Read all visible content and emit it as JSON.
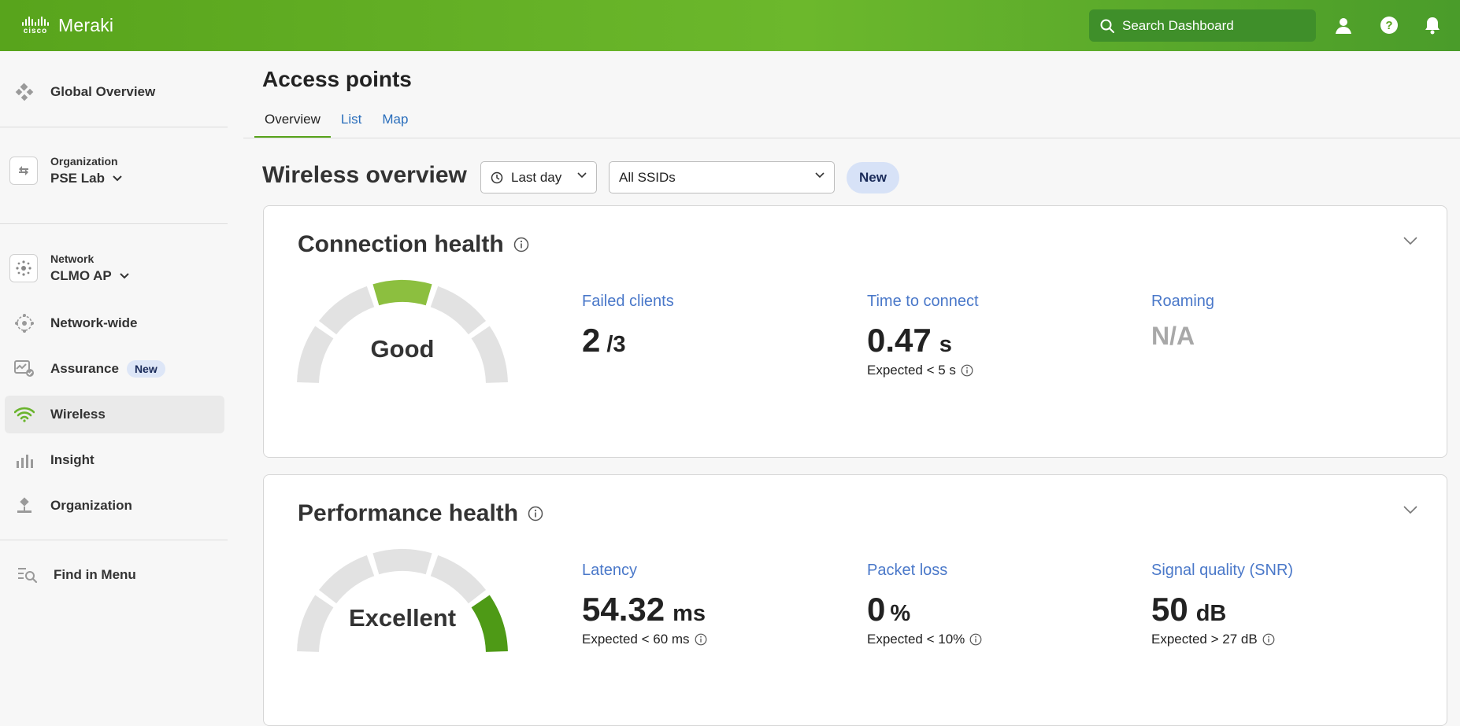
{
  "app": {
    "brand_small": "cisco",
    "brand": "Meraki"
  },
  "header": {
    "search_placeholder": "Search Dashboard"
  },
  "sidebar": {
    "global_overview": "Global Overview",
    "organization": {
      "label": "Organization",
      "value": "PSE Lab"
    },
    "network": {
      "label": "Network",
      "value": "CLMO AP"
    },
    "items": [
      {
        "label": "Network-wide"
      },
      {
        "label": "Assurance",
        "badge": "New"
      },
      {
        "label": "Wireless"
      },
      {
        "label": "Insight"
      },
      {
        "label": "Organization"
      }
    ],
    "find_in_menu": "Find in Menu"
  },
  "page": {
    "title": "Access points",
    "tabs": [
      "Overview",
      "List",
      "Map"
    ],
    "overview_title": "Wireless overview",
    "time_filter": "Last day",
    "ssid_filter": "All SSIDs",
    "new_badge": "New"
  },
  "connection_health": {
    "title": "Connection health",
    "gauge": {
      "label": "Good",
      "filled_segment": 3,
      "segments": 5,
      "color": "#8cbf3f"
    },
    "metrics": {
      "failed_clients": {
        "label": "Failed clients",
        "value": "2",
        "unit": "/3"
      },
      "time_to_connect": {
        "label": "Time to connect",
        "value": "0.47",
        "unit": "s",
        "expected": "Expected < 5 s"
      },
      "roaming": {
        "label": "Roaming",
        "value": "N/A"
      }
    }
  },
  "performance_health": {
    "title": "Performance health",
    "gauge": {
      "label": "Excellent",
      "filled_segment": 5,
      "segments": 5,
      "color": "#4e9a16"
    },
    "metrics": {
      "latency": {
        "label": "Latency",
        "value": "54.32",
        "unit": "ms",
        "expected": "Expected < 60 ms"
      },
      "packet_loss": {
        "label": "Packet loss",
        "value": "0",
        "unit": "%",
        "expected": "Expected < 10%"
      },
      "snr": {
        "label": "Signal quality (SNR)",
        "value": "50",
        "unit": "dB",
        "expected": "Expected > 27 dB"
      }
    }
  },
  "colors": {
    "brand_green": "#58a41c",
    "link_blue": "#4a78c9",
    "gauge_empty": "#e2e2e2"
  }
}
